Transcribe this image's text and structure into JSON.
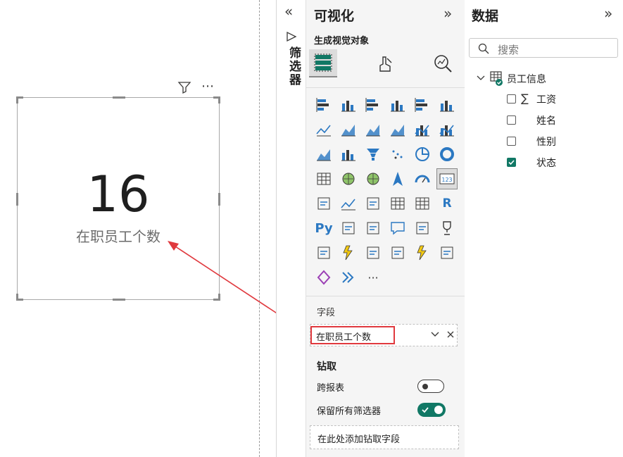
{
  "card": {
    "value": "16",
    "label": "在职员工个数",
    "more_glyph": "⋯"
  },
  "filters_pane": {
    "title": "筛选器",
    "collapse_glyph": "«"
  },
  "visualizations_pane": {
    "title": "可视化",
    "expand_glyph": "»",
    "subtitle": "生成视觉对象",
    "more_visuals_glyph": "···",
    "gallery_icons": [
      "stacked-bar-chart-icon",
      "stacked-column-chart-icon",
      "clustered-bar-chart-icon",
      "clustered-column-chart-icon",
      "100-stacked-bar-chart-icon",
      "100-stacked-column-chart-icon",
      "line-chart-icon",
      "area-chart-icon",
      "stacked-area-chart-icon",
      "100-stacked-area-chart-icon",
      "line-and-stacked-column-chart-icon",
      "line-and-clustered-column-chart-icon",
      "ribbon-chart-icon",
      "waterfall-chart-icon",
      "funnel-chart-icon",
      "scatter-chart-icon",
      "pie-chart-icon",
      "donut-chart-icon",
      "treemap-icon",
      "map-icon",
      "filled-map-icon",
      "azure-map-icon",
      "gauge-icon",
      "card-icon",
      "multi-row-card-icon",
      "kpi-icon",
      "slicer-icon",
      "table-icon",
      "matrix-icon",
      "r-visual-icon",
      "python-visual-icon",
      "key-influencers-icon",
      "decomposition-tree-icon",
      "qa-icon",
      "smart-narrative-icon",
      "goals-icon",
      "paginated-report-icon",
      "power-apps-icon",
      "power-automate-icon",
      "new-card-icon",
      "new-slicer-icon",
      "narrative-icon",
      "power-apps-2-icon",
      "power-automate-2-icon",
      "more-visuals-icon"
    ],
    "r_label": "R",
    "py_label": "Py",
    "fields_label": "字段",
    "field_value": "在职员工个数",
    "drill_title": "钻取",
    "cross_report_label": "跨报表",
    "cross_report_on": false,
    "keep_filters_label": "保留所有筛选器",
    "keep_filters_on": true,
    "drill_well_placeholder": "在此处添加钻取字段"
  },
  "data_pane": {
    "title": "数据",
    "expand_glyph": "»",
    "search_placeholder": "搜索",
    "table": {
      "name": "员工信息",
      "fields": [
        {
          "label": "工资",
          "checked": false,
          "sigma": true
        },
        {
          "label": "姓名",
          "checked": false,
          "sigma": false
        },
        {
          "label": "性别",
          "checked": false,
          "sigma": false
        },
        {
          "label": "状态",
          "checked": true,
          "sigma": false
        }
      ]
    }
  },
  "colors": {
    "accent_teal": "#117865",
    "annotation_red": "#e0393e",
    "icon_blue": "#2b78c2",
    "icon_yellow": "#f2c811"
  }
}
